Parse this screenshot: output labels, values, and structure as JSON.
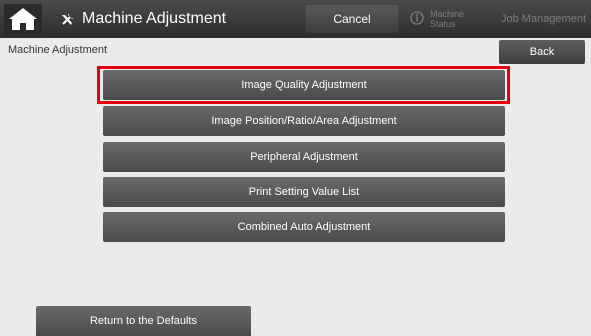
{
  "header": {
    "title": "Machine Adjustment",
    "cancel_label": "Cancel",
    "machine_status_label": "Machine\nStatus",
    "job_management_label": "Job Management"
  },
  "breadcrumb": "Machine Adjustment",
  "back_label": "Back",
  "menu": {
    "items": [
      {
        "label": "Image Quality Adjustment",
        "selected": true
      },
      {
        "label": "Image Position/Ratio/Area Adjustment",
        "selected": false
      },
      {
        "label": "Peripheral Adjustment",
        "selected": false
      },
      {
        "label": "Print Setting Value List",
        "selected": false
      },
      {
        "label": "Combined Auto Adjustment",
        "selected": false
      }
    ]
  },
  "footer": {
    "return_defaults_label": "Return to the Defaults"
  },
  "colors": {
    "highlight": "#e3000f",
    "button_bg": "#5a5a5a",
    "page_bg": "#ebebeb"
  },
  "icons": {
    "home": "home-icon",
    "tools": "tools-icon",
    "info": "info-icon"
  }
}
